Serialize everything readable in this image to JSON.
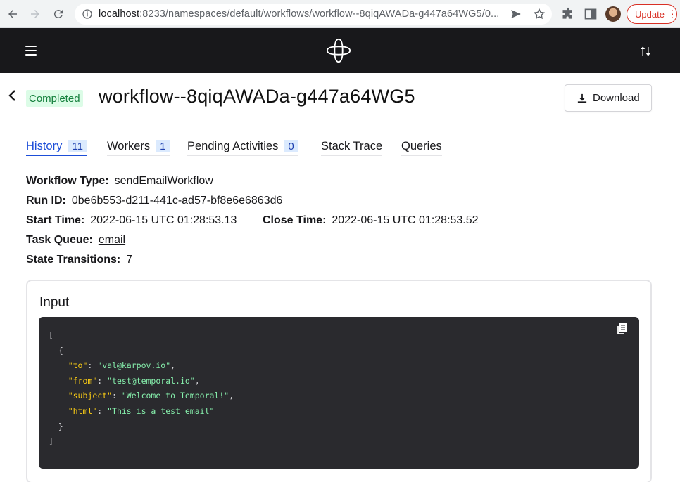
{
  "browser": {
    "url_host": "localhost",
    "url_rest": ":8233/namespaces/default/workflows/workflow--8qiqAWADa-g447a64WG5/0...",
    "update_label": "Update"
  },
  "header": {
    "status": "Completed",
    "title": "workflow--8qiqAWADa-g447a64WG5",
    "download_label": "Download"
  },
  "tabs": [
    {
      "label": "History",
      "count": "11"
    },
    {
      "label": "Workers",
      "count": "1"
    },
    {
      "label": "Pending Activities",
      "count": "0"
    },
    {
      "label": "Stack Trace"
    },
    {
      "label": "Queries"
    }
  ],
  "details": {
    "workflow_type_label": "Workflow Type:",
    "workflow_type": "sendEmailWorkflow",
    "run_id_label": "Run ID:",
    "run_id": "0be6b553-d211-441c-ad57-bf8e6e6863d6",
    "start_time_label": "Start Time:",
    "start_time": "2022-06-15 UTC 01:28:53.13",
    "close_time_label": "Close Time:",
    "close_time": "2022-06-15 UTC 01:28:53.52",
    "task_queue_label": "Task Queue:",
    "task_queue": "email",
    "state_transitions_label": "State Transitions:",
    "state_transitions": "7"
  },
  "input": {
    "title": "Input",
    "open_bracket": "[",
    "open_brace": "{",
    "fields": [
      {
        "key": "\"to\"",
        "value": "\"val@karpov.io\"",
        "trail": ","
      },
      {
        "key": "\"from\"",
        "value": "\"test@temporal.io\"",
        "trail": ","
      },
      {
        "key": "\"subject\"",
        "value": "\"Welcome to Temporal!\"",
        "trail": ","
      },
      {
        "key": "\"html\"",
        "value": "\"This is a test email\"",
        "trail": ""
      }
    ],
    "close_brace": "}",
    "close_bracket": "]"
  },
  "colors": {
    "appbar": "#18181b",
    "active_tab": "#1d4ed8",
    "status_bg": "#dcfce7",
    "status_fg": "#15803d",
    "json_key": "#facc15",
    "json_string": "#86efac"
  }
}
